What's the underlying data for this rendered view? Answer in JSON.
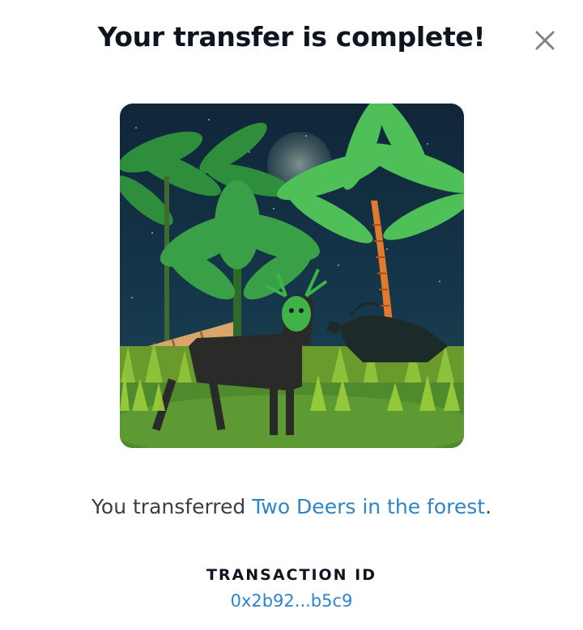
{
  "modal": {
    "title": "Your transfer is complete!",
    "close_icon": "close-icon"
  },
  "nft": {
    "image_icon": "nft-artwork-deers-forest"
  },
  "transfer": {
    "prefix": "You transferred ",
    "item_name": "Two Deers in the forest",
    "suffix": "."
  },
  "transaction": {
    "label": "TRANSACTION ID",
    "id": "0x2b92...b5c9"
  },
  "colors": {
    "title": "#0d1520",
    "link": "#2e84c8",
    "body_text": "#3a3f45",
    "close_icon": "#7d858c"
  }
}
